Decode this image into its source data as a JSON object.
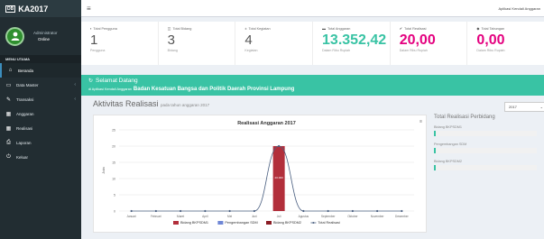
{
  "app": {
    "title": "KA2017",
    "logo_text": "DB"
  },
  "topbar": {
    "user": "Aplikasi Kendali Anggaran"
  },
  "sidebar": {
    "user_name": "Administrator",
    "user_status": "Online",
    "menu_header": "MENU UTAMA",
    "items": [
      {
        "label": "Beranda",
        "icon": "home-icon",
        "glyph": "⌂"
      },
      {
        "label": "Data Master",
        "icon": "folder-icon",
        "glyph": "▭"
      },
      {
        "label": "Transaksi",
        "icon": "edit-icon",
        "glyph": "✎"
      },
      {
        "label": "Anggaran",
        "icon": "bar-chart-icon",
        "glyph": "▦"
      },
      {
        "label": "Realisasi",
        "icon": "bar-chart-icon",
        "glyph": "▦"
      },
      {
        "label": "Laporan",
        "icon": "print-icon",
        "glyph": "⎙"
      },
      {
        "label": "Keluar",
        "icon": "logout-icon",
        "glyph": "⏻"
      }
    ]
  },
  "stats": [
    {
      "label": "Total Pengguna",
      "value": "1",
      "sub": "Pengguna",
      "icon": "users-icon",
      "glyph": "▪",
      "big": false,
      "color": "#555555"
    },
    {
      "label": "Total Bidang",
      "value": "3",
      "sub": "Bidang",
      "icon": "sitemap-icon",
      "glyph": "◫",
      "big": false,
      "color": "#555555"
    },
    {
      "label": "Total Kegiatan",
      "value": "4",
      "sub": "Kegiatan",
      "icon": "tasks-icon",
      "glyph": "±",
      "big": false,
      "color": "#555555"
    },
    {
      "label": "Total Anggaran",
      "value": "13.352,42",
      "sub": "Dalam Ribu Rupiah",
      "icon": "money-icon",
      "glyph": "▬",
      "big": true,
      "color": "#39c3a4"
    },
    {
      "label": "Total Realisasi",
      "value": "20,00",
      "sub": "Dalam Ribu Rupiah",
      "icon": "check-icon",
      "glyph": "✔",
      "big": true,
      "color": "#e4007f"
    },
    {
      "label": "Total Tabungan",
      "value": "0,00",
      "sub": "Dalam Ribu Rupiah",
      "icon": "piggy-icon",
      "glyph": "◆",
      "big": true,
      "color": "#e4007f"
    }
  ],
  "welcome": {
    "title": "Selamat Datang",
    "subtitle": "di Aplikasi Kendali Anggaran",
    "org": "Badan Kesatuan Bangsa dan Politik Daerah Provinsi Lampung"
  },
  "activity": {
    "heading": "Aktivitas Realisasi",
    "sub": "pada tahun anggaran 2017"
  },
  "year_select": {
    "value": "2017"
  },
  "right_panel": {
    "title": "Total Realisasi Perbidang",
    "items": [
      {
        "label": "Bidang BKPSDM1",
        "progress": 0.01
      },
      {
        "label": "Pengembangan SDM",
        "progress": 0.01
      },
      {
        "label": "Bidang BKPSDM2",
        "progress": 0.01
      }
    ]
  },
  "chart_data": {
    "type": "bar",
    "title": "Realisasi Anggaran 2017",
    "ylabel": "Juta",
    "ylim": [
      0,
      25
    ],
    "yticks": [
      0,
      5,
      10,
      15,
      20,
      25
    ],
    "categories": [
      "Januari",
      "Februari",
      "Maret",
      "April",
      "Mei",
      "Juni",
      "Juli",
      "Agustus",
      "September",
      "Oktober",
      "November",
      "Desember"
    ],
    "series": [
      {
        "name": "Bidang BKPSDM1",
        "type": "bar",
        "color": "#b22f3b",
        "values": [
          0,
          0,
          0,
          0,
          0,
          0,
          20,
          0,
          0,
          0,
          0,
          0
        ]
      },
      {
        "name": "Pengembangan SDM",
        "type": "bar",
        "color": "#6f87d6",
        "values": [
          0,
          0,
          0,
          0,
          0,
          0,
          0,
          0,
          0,
          0,
          0,
          0
        ]
      },
      {
        "name": "Bidang BKPSDM2",
        "type": "bar",
        "color": "#8b1c24",
        "values": [
          0,
          0,
          0,
          0,
          0,
          0,
          0,
          0,
          0,
          0,
          0,
          0
        ]
      },
      {
        "name": "Total Realisasi",
        "type": "line",
        "color": "#4a5f80",
        "values": [
          0,
          0,
          0,
          0,
          0,
          0,
          20,
          0,
          0,
          0,
          0,
          0
        ]
      }
    ],
    "bar_label": "20.000",
    "grid": true,
    "legend": "bottom"
  }
}
